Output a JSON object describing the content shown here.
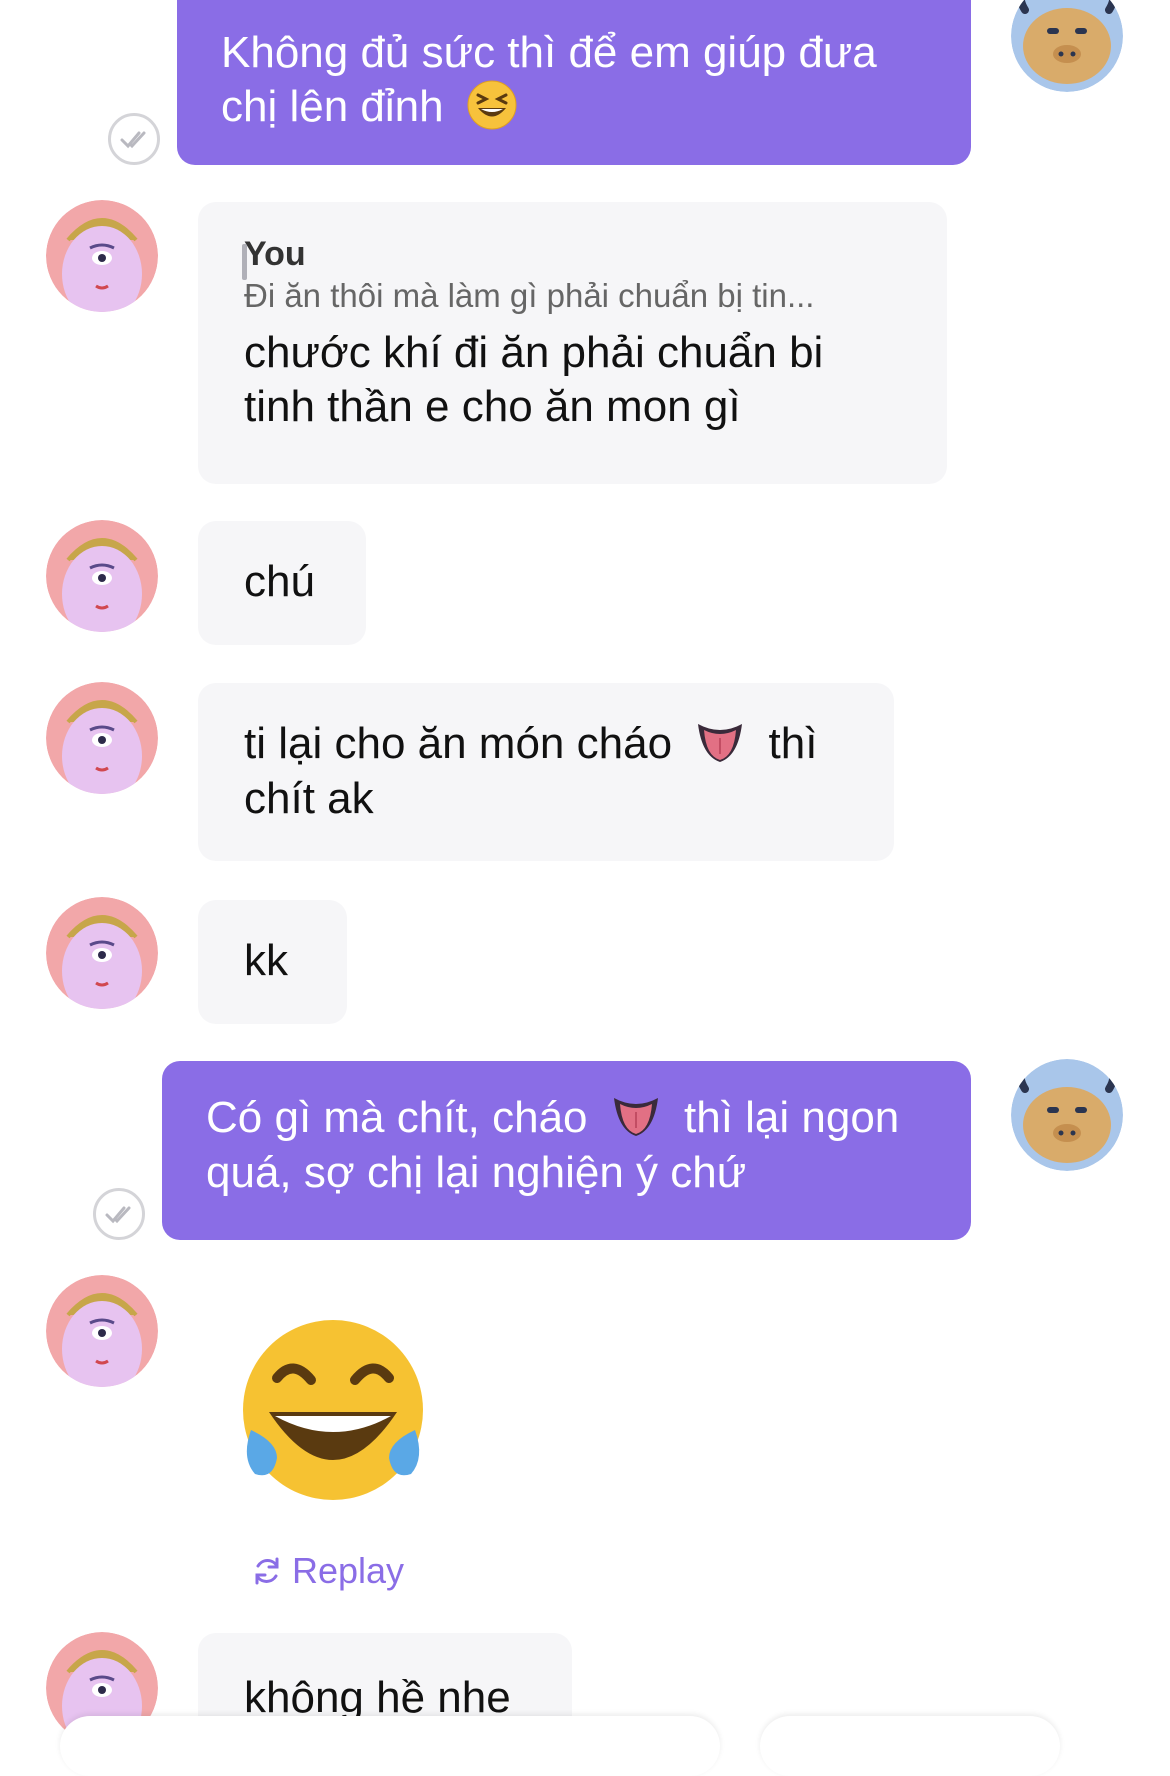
{
  "messages": {
    "m1": {
      "text": "Không đủ sức thì để em giúp đưa chị lên đỉnh"
    },
    "m2": {
      "quote_author": "You",
      "quote_text": "Đi ăn thôi mà làm gì phải chuẩn bị tin...",
      "text": "chước khí đi ăn phải chuẩn bi tinh thần e cho ăn mon gì"
    },
    "m3": {
      "text": "chú"
    },
    "m4": {
      "text_before": "ti lại cho ăn món cháo",
      "text_after": "thì chít ak"
    },
    "m5": {
      "text": "kk"
    },
    "m6": {
      "text_before": "Có gì mà chít, cháo",
      "text_after": "thì lại ngon quá, sợ chị lại nghiện ý chứ"
    },
    "m7": {
      "emoji": "face-with-tears-of-joy"
    },
    "m8": {
      "text": "không hề nhe"
    }
  },
  "replay_label": "Replay",
  "colors": {
    "outgoing_bubble": "#8a6de6",
    "incoming_bubble": "#f6f6f8",
    "accent": "#8a6de6"
  },
  "icons": {
    "read_receipt": "double-check-icon",
    "replay": "replay-icon",
    "emoji_laughing": "grinning-squinting-face",
    "emoji_tongue": "mouth-tongue"
  }
}
